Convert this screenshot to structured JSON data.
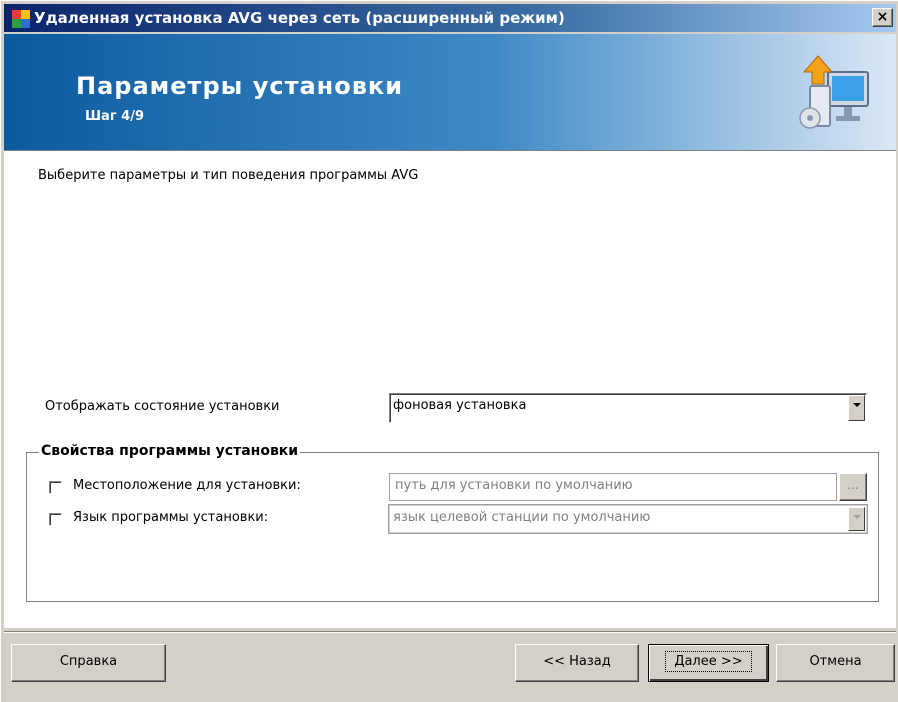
{
  "window": {
    "title": "Удаленная установка AVG через сеть (расширенный режим)",
    "close_glyph": "×"
  },
  "header": {
    "title": "Параметры установки",
    "step": "Шаг 4/9"
  },
  "content": {
    "intro": "Выберите параметры и тип поведения программы AVG",
    "display_status_label": "Отображать состояние установки",
    "display_status_value": "фоновая установка",
    "group_title": "Свойства программы установки",
    "location": {
      "label": "Местоположение для установки:",
      "placeholder": "путь для установки по умолчанию",
      "browse_label": "...",
      "checked": false
    },
    "language": {
      "label": "Язык программы установки:",
      "value": "язык целевой станции по умолчанию",
      "checked": false
    }
  },
  "footer": {
    "help_label": "Справка",
    "back_label": "<< Назад",
    "next_label": "Далее >>",
    "cancel_label": "Отмена"
  },
  "colors": {
    "banner_start": "#0c5aa0",
    "titlebar_start": "#0a246a",
    "dialog_face": "#d4d0c8"
  },
  "icons": [
    "avg-app-icon",
    "computer-install-icon",
    "close-icon",
    "dropdown-arrow-icon"
  ]
}
